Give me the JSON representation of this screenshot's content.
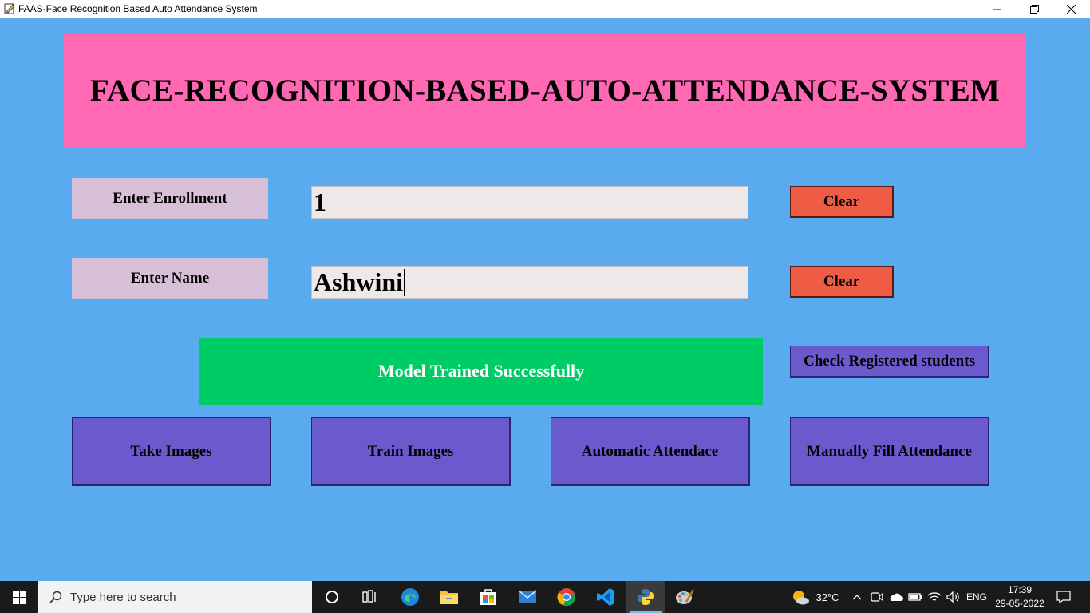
{
  "window": {
    "title": "FAAS-Face Recognition Based Auto Attendance System"
  },
  "app": {
    "banner_title": "FACE-RECOGNITION-BASED-AUTO-ATTENDANCE-SYSTEM",
    "enrollment": {
      "label": "Enter Enrollment",
      "value": "1",
      "clear_label": "Clear"
    },
    "name": {
      "label": "Enter Name",
      "value": "Ashwini",
      "clear_label": "Clear"
    },
    "notification": "Model Trained Successfully",
    "check_registered_label": "Check Registered students",
    "actions": {
      "take_images": "Take Images",
      "train_images": "Train Images",
      "automatic_attendance": "Automatic Attendace",
      "manual_attendance": "Manually Fill Attendance"
    },
    "colors": {
      "background": "#5aaaf0",
      "banner": "#ff69b4",
      "label_box": "#d8bfd8",
      "input": "#efe8e8",
      "clear_button": "#ee5c46",
      "notification": "#00cc66",
      "action_button": "#6a5acd"
    }
  },
  "taskbar": {
    "search_placeholder": "Type here to search",
    "apps": [
      "cortana-icon",
      "task-view-icon",
      "edge-icon",
      "file-explorer-icon",
      "store-icon",
      "mail-icon",
      "chrome-icon",
      "vscode-icon",
      "python-icon",
      "paint-icon"
    ],
    "weather": "32°C",
    "language": "ENG",
    "time": "17:39",
    "date": "29-05-2022"
  }
}
